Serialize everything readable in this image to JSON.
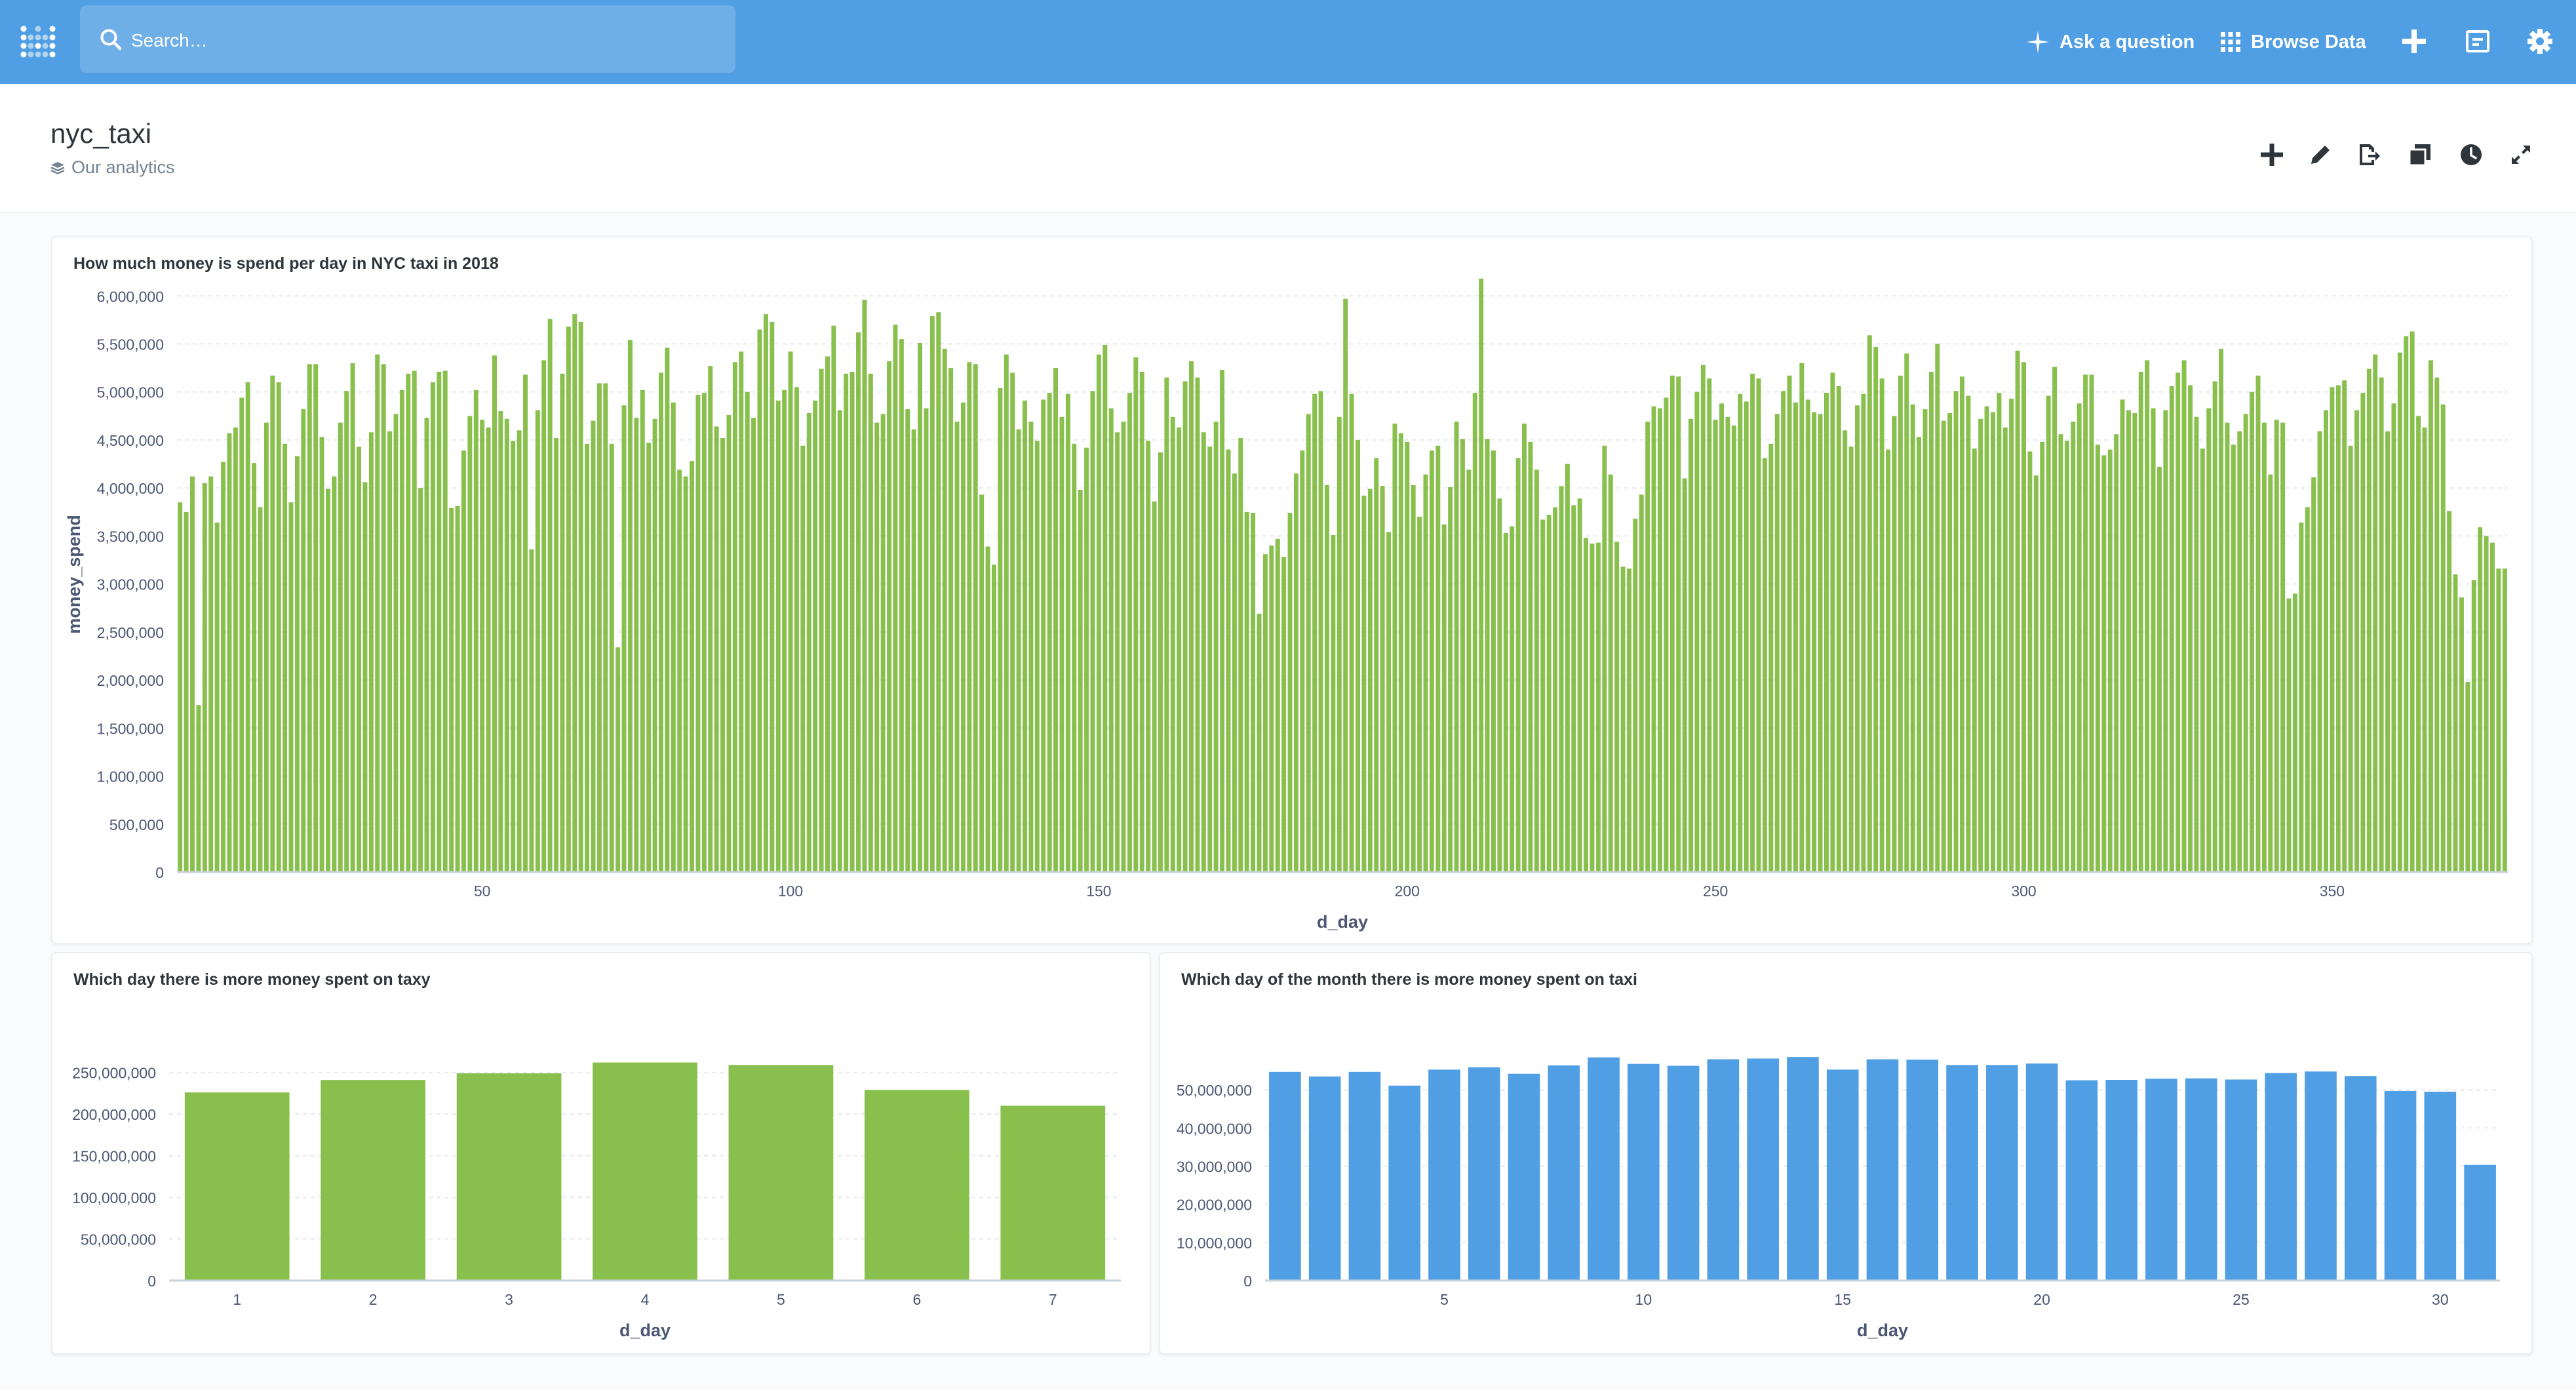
{
  "nav": {
    "search_placeholder": "Search…",
    "ask_label": "Ask a question",
    "browse_label": "Browse Data",
    "accent": "#509ee3"
  },
  "header": {
    "title": "nyc_taxi",
    "collection": "Our analytics",
    "actions": [
      "plus-icon",
      "pencil-icon",
      "export-icon",
      "duplicate-icon",
      "clock-icon",
      "fullscreen-icon"
    ]
  },
  "charts": {
    "daily": {
      "title": "How much money is spend per day in NYC taxi in 2018"
    },
    "weekday": {
      "title": "Which day there is more money spent on taxy"
    },
    "monthday": {
      "title": "Which day of the month there is more money spent on taxi"
    }
  },
  "chart_data": [
    {
      "type": "bar",
      "title": "How much money is spend per day in NYC taxi in 2018",
      "xlabel": "d_day",
      "ylabel": "money_spend",
      "color": "#88bf4d",
      "xlim": [
        1,
        365
      ],
      "xticks": [
        50,
        100,
        150,
        200,
        250,
        300,
        350
      ],
      "ylim": [
        0,
        6200000
      ],
      "yticks": [
        0,
        500000,
        1000000,
        1500000,
        2000000,
        2500000,
        3000000,
        3500000,
        4000000,
        4500000,
        5000000,
        5500000,
        6000000
      ],
      "grid": true,
      "x": [
        1,
        2,
        3,
        4,
        5,
        6,
        7,
        8,
        9,
        10,
        11,
        12,
        13,
        14,
        15,
        16,
        17,
        18,
        19,
        20,
        21,
        22,
        23,
        24,
        25,
        26,
        27,
        28,
        29,
        30,
        31,
        32,
        33,
        34,
        35,
        36,
        37,
        38,
        39,
        40,
        41,
        42,
        43,
        44,
        45,
        46,
        47,
        48,
        49,
        50,
        51,
        52,
        53,
        54,
        55,
        56,
        57,
        58,
        59,
        60,
        61,
        62,
        63,
        64,
        65,
        66,
        67,
        68,
        69,
        70,
        71,
        72,
        73,
        74,
        75,
        76,
        77,
        78,
        79,
        80,
        81,
        82,
        83,
        84,
        85,
        86,
        87,
        88,
        89,
        90,
        91,
        92,
        93,
        94,
        95,
        96,
        97,
        98,
        99,
        100,
        101,
        102,
        103,
        104,
        105,
        106,
        107,
        108,
        109,
        110,
        111,
        112,
        113,
        114,
        115,
        116,
        117,
        118,
        119,
        120,
        121,
        122,
        123,
        124,
        125,
        126,
        127,
        128,
        129,
        130,
        131,
        132,
        133,
        134,
        135,
        136,
        137,
        138,
        139,
        140,
        141,
        142,
        143,
        144,
        145,
        146,
        147,
        148,
        149,
        150,
        151,
        152,
        153,
        154,
        155,
        156,
        157,
        158,
        159,
        160,
        161,
        162,
        163,
        164,
        165,
        166,
        167,
        168,
        169,
        170,
        171,
        172,
        173,
        174,
        175,
        176,
        177,
        178,
        179,
        180,
        181,
        182,
        183,
        184,
        185,
        186,
        187,
        188,
        189,
        190,
        191,
        192,
        193,
        194,
        195,
        196,
        197,
        198,
        199,
        200,
        201,
        202,
        203,
        204,
        205,
        206,
        207,
        208,
        209,
        210,
        211,
        212,
        213,
        214,
        215,
        216,
        217,
        218,
        219,
        220,
        221,
        222,
        223,
        224,
        225,
        226,
        227,
        228,
        229,
        230,
        231,
        232,
        233,
        234,
        235,
        236,
        237,
        238,
        239,
        240,
        241,
        242,
        243,
        244,
        245,
        246,
        247,
        248,
        249,
        250,
        251,
        252,
        253,
        254,
        255,
        256,
        257,
        258,
        259,
        260,
        261,
        262,
        263,
        264,
        265,
        266,
        267,
        268,
        269,
        270,
        271,
        272,
        273,
        274,
        275,
        276,
        277,
        278,
        279,
        280,
        281,
        282,
        283,
        284,
        285,
        286,
        287,
        288,
        289,
        290,
        291,
        292,
        293,
        294,
        295,
        296,
        297,
        298,
        299,
        300,
        301,
        302,
        303,
        304,
        305,
        306,
        307,
        308,
        309,
        310,
        311,
        312,
        313,
        314,
        315,
        316,
        317,
        318,
        319,
        320,
        321,
        322,
        323,
        324,
        325,
        326,
        327,
        328,
        329,
        330,
        331,
        332,
        333,
        334,
        335,
        336,
        337,
        338,
        339,
        340,
        341,
        342,
        343,
        344,
        345,
        346,
        347,
        348,
        349,
        350,
        351,
        352,
        353,
        354,
        355,
        356,
        357,
        358,
        359,
        360,
        361,
        362,
        363,
        364,
        365
      ],
      "values": [
        3850000,
        3750000,
        4120000,
        1740000,
        4050000,
        4120000,
        3640000,
        4270000,
        4570000,
        4630000,
        4940000,
        5100000,
        4260000,
        3800000,
        4680000,
        5170000,
        5100000,
        4460000,
        3850000,
        4330000,
        4820000,
        5290000,
        5290000,
        4530000,
        3990000,
        4120000,
        4680000,
        5010000,
        5300000,
        4430000,
        4060000,
        4580000,
        5390000,
        5290000,
        4590000,
        4770000,
        5020000,
        5190000,
        5220000,
        4000000,
        4730000,
        5100000,
        5210000,
        5220000,
        3790000,
        3810000,
        4390000,
        4750000,
        5020000,
        4710000,
        4630000,
        5380000,
        4800000,
        4720000,
        4490000,
        4600000,
        5180000,
        3360000,
        4810000,
        5330000,
        5760000,
        4520000,
        5190000,
        5680000,
        5810000,
        5730000,
        4460000,
        4700000,
        5090000,
        5090000,
        4460000,
        2340000,
        4860000,
        5540000,
        4730000,
        5020000,
        4470000,
        4720000,
        5200000,
        5460000,
        4890000,
        4190000,
        4120000,
        4280000,
        4970000,
        4990000,
        5270000,
        4640000,
        4520000,
        4760000,
        5310000,
        5420000,
        5000000,
        4730000,
        5650000,
        5810000,
        5730000,
        4910000,
        5020000,
        5420000,
        5050000,
        4440000,
        4780000,
        4910000,
        5240000,
        5370000,
        5690000,
        4810000,
        5190000,
        5210000,
        5620000,
        5960000,
        5190000,
        4680000,
        4770000,
        5320000,
        5700000,
        5550000,
        4820000,
        4610000,
        5510000,
        4830000,
        5790000,
        5830000,
        5450000,
        5250000,
        4690000,
        4890000,
        5310000,
        5290000,
        3930000,
        3390000,
        3200000,
        5040000,
        5390000,
        5200000,
        4610000,
        4910000,
        4690000,
        4490000,
        4920000,
        4990000,
        5250000,
        4740000,
        4980000,
        4460000,
        3980000,
        4420000,
        5010000,
        5390000,
        5490000,
        4830000,
        4580000,
        4690000,
        4990000,
        5360000,
        5210000,
        4490000,
        3860000,
        4370000,
        5150000,
        4740000,
        4630000,
        5110000,
        5320000,
        5150000,
        4580000,
        4430000,
        4690000,
        5230000,
        4400000,
        4150000,
        4520000,
        3750000,
        3740000,
        2690000,
        3310000,
        3400000,
        3470000,
        3280000,
        3740000,
        4150000,
        4390000,
        4770000,
        4980000,
        5010000,
        4030000,
        3510000,
        4740000,
        5970000,
        4980000,
        4500000,
        3920000,
        3990000,
        4310000,
        4020000,
        3540000,
        4670000,
        4570000,
        4480000,
        4030000,
        3700000,
        4140000,
        4390000,
        4440000,
        3620000,
        4010000,
        4690000,
        4510000,
        4190000,
        4990000,
        6180000,
        4510000,
        4390000,
        3890000,
        3530000,
        3600000,
        4310000,
        4670000,
        4480000,
        4190000,
        3670000,
        3720000,
        3800000,
        4020000,
        4250000,
        3820000,
        3890000,
        3480000,
        3420000,
        3430000,
        4440000,
        4140000,
        3440000,
        3180000,
        3160000,
        3680000,
        3930000,
        4690000,
        4850000,
        4830000,
        4940000,
        5170000,
        5160000,
        4100000,
        4720000,
        5000000,
        5280000,
        5140000,
        4710000,
        4880000,
        4740000,
        4650000,
        4980000,
        4900000,
        5190000,
        5140000,
        4310000,
        4460000,
        4770000,
        5010000,
        5170000,
        4890000,
        5300000,
        4920000,
        4790000,
        4770000,
        4990000,
        5200000,
        5060000,
        4600000,
        4430000,
        4860000,
        4980000,
        5590000,
        5470000,
        5140000,
        4400000,
        4750000,
        5170000,
        5400000,
        4870000,
        4530000,
        4820000,
        5210000,
        5500000,
        4700000,
        4780000,
        5010000,
        5160000,
        4960000,
        4410000,
        4720000,
        4850000,
        4790000,
        4990000,
        4630000,
        4930000,
        5430000,
        5310000,
        4380000,
        4130000,
        4480000,
        4960000,
        5260000,
        4560000,
        4490000,
        4690000,
        4880000,
        5180000,
        5180000,
        4450000,
        4340000,
        4400000,
        4560000,
        4920000,
        4810000,
        4780000,
        5210000,
        5330000,
        4830000,
        4220000,
        4810000,
        5060000,
        5200000,
        5330000,
        5070000,
        4740000,
        4410000,
        4830000,
        5110000,
        5450000,
        4680000,
        4450000,
        4590000,
        4770000,
        5000000,
        5170000,
        4680000,
        4140000,
        4710000,
        4680000,
        2850000,
        2900000,
        3640000,
        3800000,
        4110000,
        4590000,
        4810000,
        5050000,
        5070000,
        5120000,
        4440000,
        4810000,
        4990000,
        5240000,
        5390000,
        5150000,
        4590000,
        4880000,
        5410000,
        5580000,
        5630000,
        4750000,
        4630000,
        5330000,
        5150000,
        4870000,
        3760000,
        3100000,
        2860000,
        1980000,
        3040000,
        3590000,
        3500000,
        3430000,
        3160000,
        3160000
      ]
    },
    {
      "type": "bar",
      "title": "Which day there is more money spent on taxy",
      "xlabel": "d_day",
      "ylabel": "",
      "color": "#88bf4d",
      "categories": [
        "1",
        "2",
        "3",
        "4",
        "5",
        "6",
        "7"
      ],
      "values": [
        226000000,
        241000000,
        249000000,
        262000000,
        259000000,
        229000000,
        210000000
      ],
      "ylim": [
        0,
        275000000
      ],
      "yticks": [
        0,
        50000000,
        100000000,
        150000000,
        200000000,
        250000000
      ],
      "grid": true
    },
    {
      "type": "bar",
      "title": "Which day of the month there is more money spent on taxi",
      "xlabel": "d_day",
      "ylabel": "",
      "color": "#509ee3",
      "x": [
        1,
        2,
        3,
        4,
        5,
        6,
        7,
        8,
        9,
        10,
        11,
        12,
        13,
        14,
        15,
        16,
        17,
        18,
        19,
        20,
        21,
        22,
        23,
        24,
        25,
        26,
        27,
        28,
        29,
        30,
        31
      ],
      "values": [
        54700000,
        53500000,
        54700000,
        51100000,
        55300000,
        55900000,
        54200000,
        56400000,
        58500000,
        56800000,
        56300000,
        58000000,
        58200000,
        58600000,
        55300000,
        58000000,
        57900000,
        56500000,
        56500000,
        56900000,
        52500000,
        52600000,
        52900000,
        53000000,
        52700000,
        54400000,
        54800000,
        53600000,
        49700000,
        49500000,
        30300000
      ],
      "xticks": [
        5,
        10,
        15,
        20,
        25,
        30
      ],
      "ylim": [
        0,
        60000000
      ],
      "yticks": [
        0,
        10000000,
        20000000,
        30000000,
        40000000,
        50000000
      ],
      "grid": true
    }
  ]
}
